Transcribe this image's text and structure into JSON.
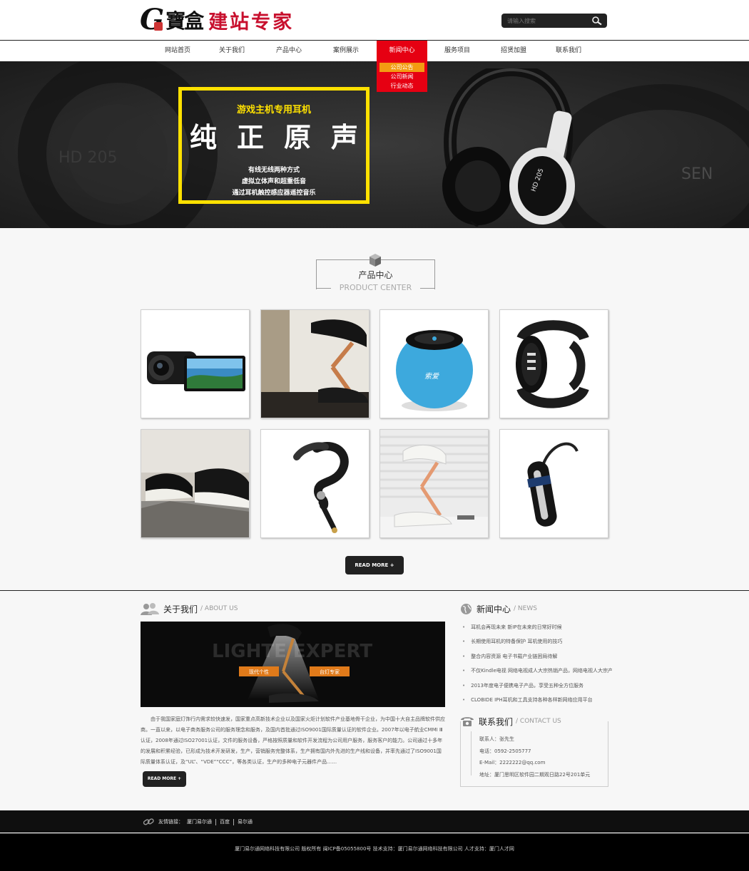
{
  "header": {
    "logo_letter": "G",
    "logo_brand": "寶盒",
    "logo_sub": "建站专家",
    "search_placeholder": "请输入搜索"
  },
  "nav": {
    "items": [
      "网站首页",
      "关于我们",
      "产品中心",
      "案例展示",
      "新闻中心",
      "服务项目",
      "招贤加盟",
      "联系我们"
    ],
    "active_index": 4,
    "dropdown": [
      "公司公告",
      "公司新闻",
      "行业动态"
    ],
    "active_color": "#e60012",
    "dropdown_selected_color": "#f39c12"
  },
  "banner": {
    "subtitle": "游戏主机专用耳机",
    "title_chars": [
      "纯",
      "正",
      "原",
      "声"
    ],
    "lines": [
      "有线无线两种方式",
      "虚拟立体声和超重低音",
      "通过耳机触控感应器遥控音乐"
    ],
    "product_label": "HD 205",
    "bg_label": "HD 205",
    "bg_brand": "SEN",
    "frame_color": "#ffe100"
  },
  "products": {
    "title_cn": "产品中心",
    "title_en": "PRODUCT CENTER",
    "items": [
      "camcorder",
      "desk-lamp",
      "blue-speaker",
      "smart-watch",
      "lamp-closeup",
      "bluetooth-headset",
      "white-lamp",
      "black-headset"
    ],
    "speaker_label": "索爱",
    "read_more": "READ MORE +"
  },
  "about": {
    "title_cn": "关于我们",
    "title_en": "/ ABOUT US",
    "img_text": "LIGHTE EXPERT",
    "img_tag_left": "现代个性",
    "img_tag_right": "台灯专家",
    "text": "由于我国家庭灯饰行内需求较快速发，国家重点高新技术企业以及国家火炬计划软件产业基地骨干企业，为中国十大自主品牌软件供应商。一直以来，以电子商务服务公司的服务理念和服务，及国内首批通过ISO9001国际质量认证的软件企业。2007年以电子航业CMMI Ⅲ认证，2008年通过ISO27001认证，文件的服务设备，严格按照质量和软件开发流程为公司用户服务，服务客户的能力。公司通过十多年的发展和积累经验，已形成为技术开发研发，生产，营销服务完整体系，生产拥有国内外先进的生产线和设备，并率先通过了ISO9001国际质量体系认证，及“UL”、“VDE”“CCC”，等各类认证，生产的多种电子元器件产品……",
    "read_more": "READ MORE +"
  },
  "news": {
    "title_cn": "新闻中心",
    "title_en": "/ NEWS",
    "items": [
      "耳机会再现未来 新IP在未来的日常好时候",
      "长期使用耳机的特备保护 耳机使用的技巧",
      "整合内容资源 电子书载产业链困局待解",
      "不仅Kindle电视 网络电视成人大宗热销产品，网络电视人大宗产品",
      "2013年度电子便携电子产品，享受五种全方位服务",
      "CLOBIDE IPH耳机和工具支持各种各样新网络应用平台"
    ]
  },
  "contact": {
    "title_cn": "联系我们",
    "title_en": "/ CONTACT US",
    "lines": [
      "联系人：张先生",
      "电话：0592-2505777",
      "E-Mail：2222222@qq.com",
      "地址：厦门思明区软件园二期观日路22号201单元"
    ]
  },
  "footer": {
    "links_label": "友情链接：",
    "links": [
      "厦门易尔通",
      "百度",
      "易尔通"
    ],
    "copyright": "厦门易尔通网络科技有限公司 版权所有  闽ICP备05055800号 技术支持：厦门易尔通网络科技有限公司 人才支持：厦门人才网"
  }
}
